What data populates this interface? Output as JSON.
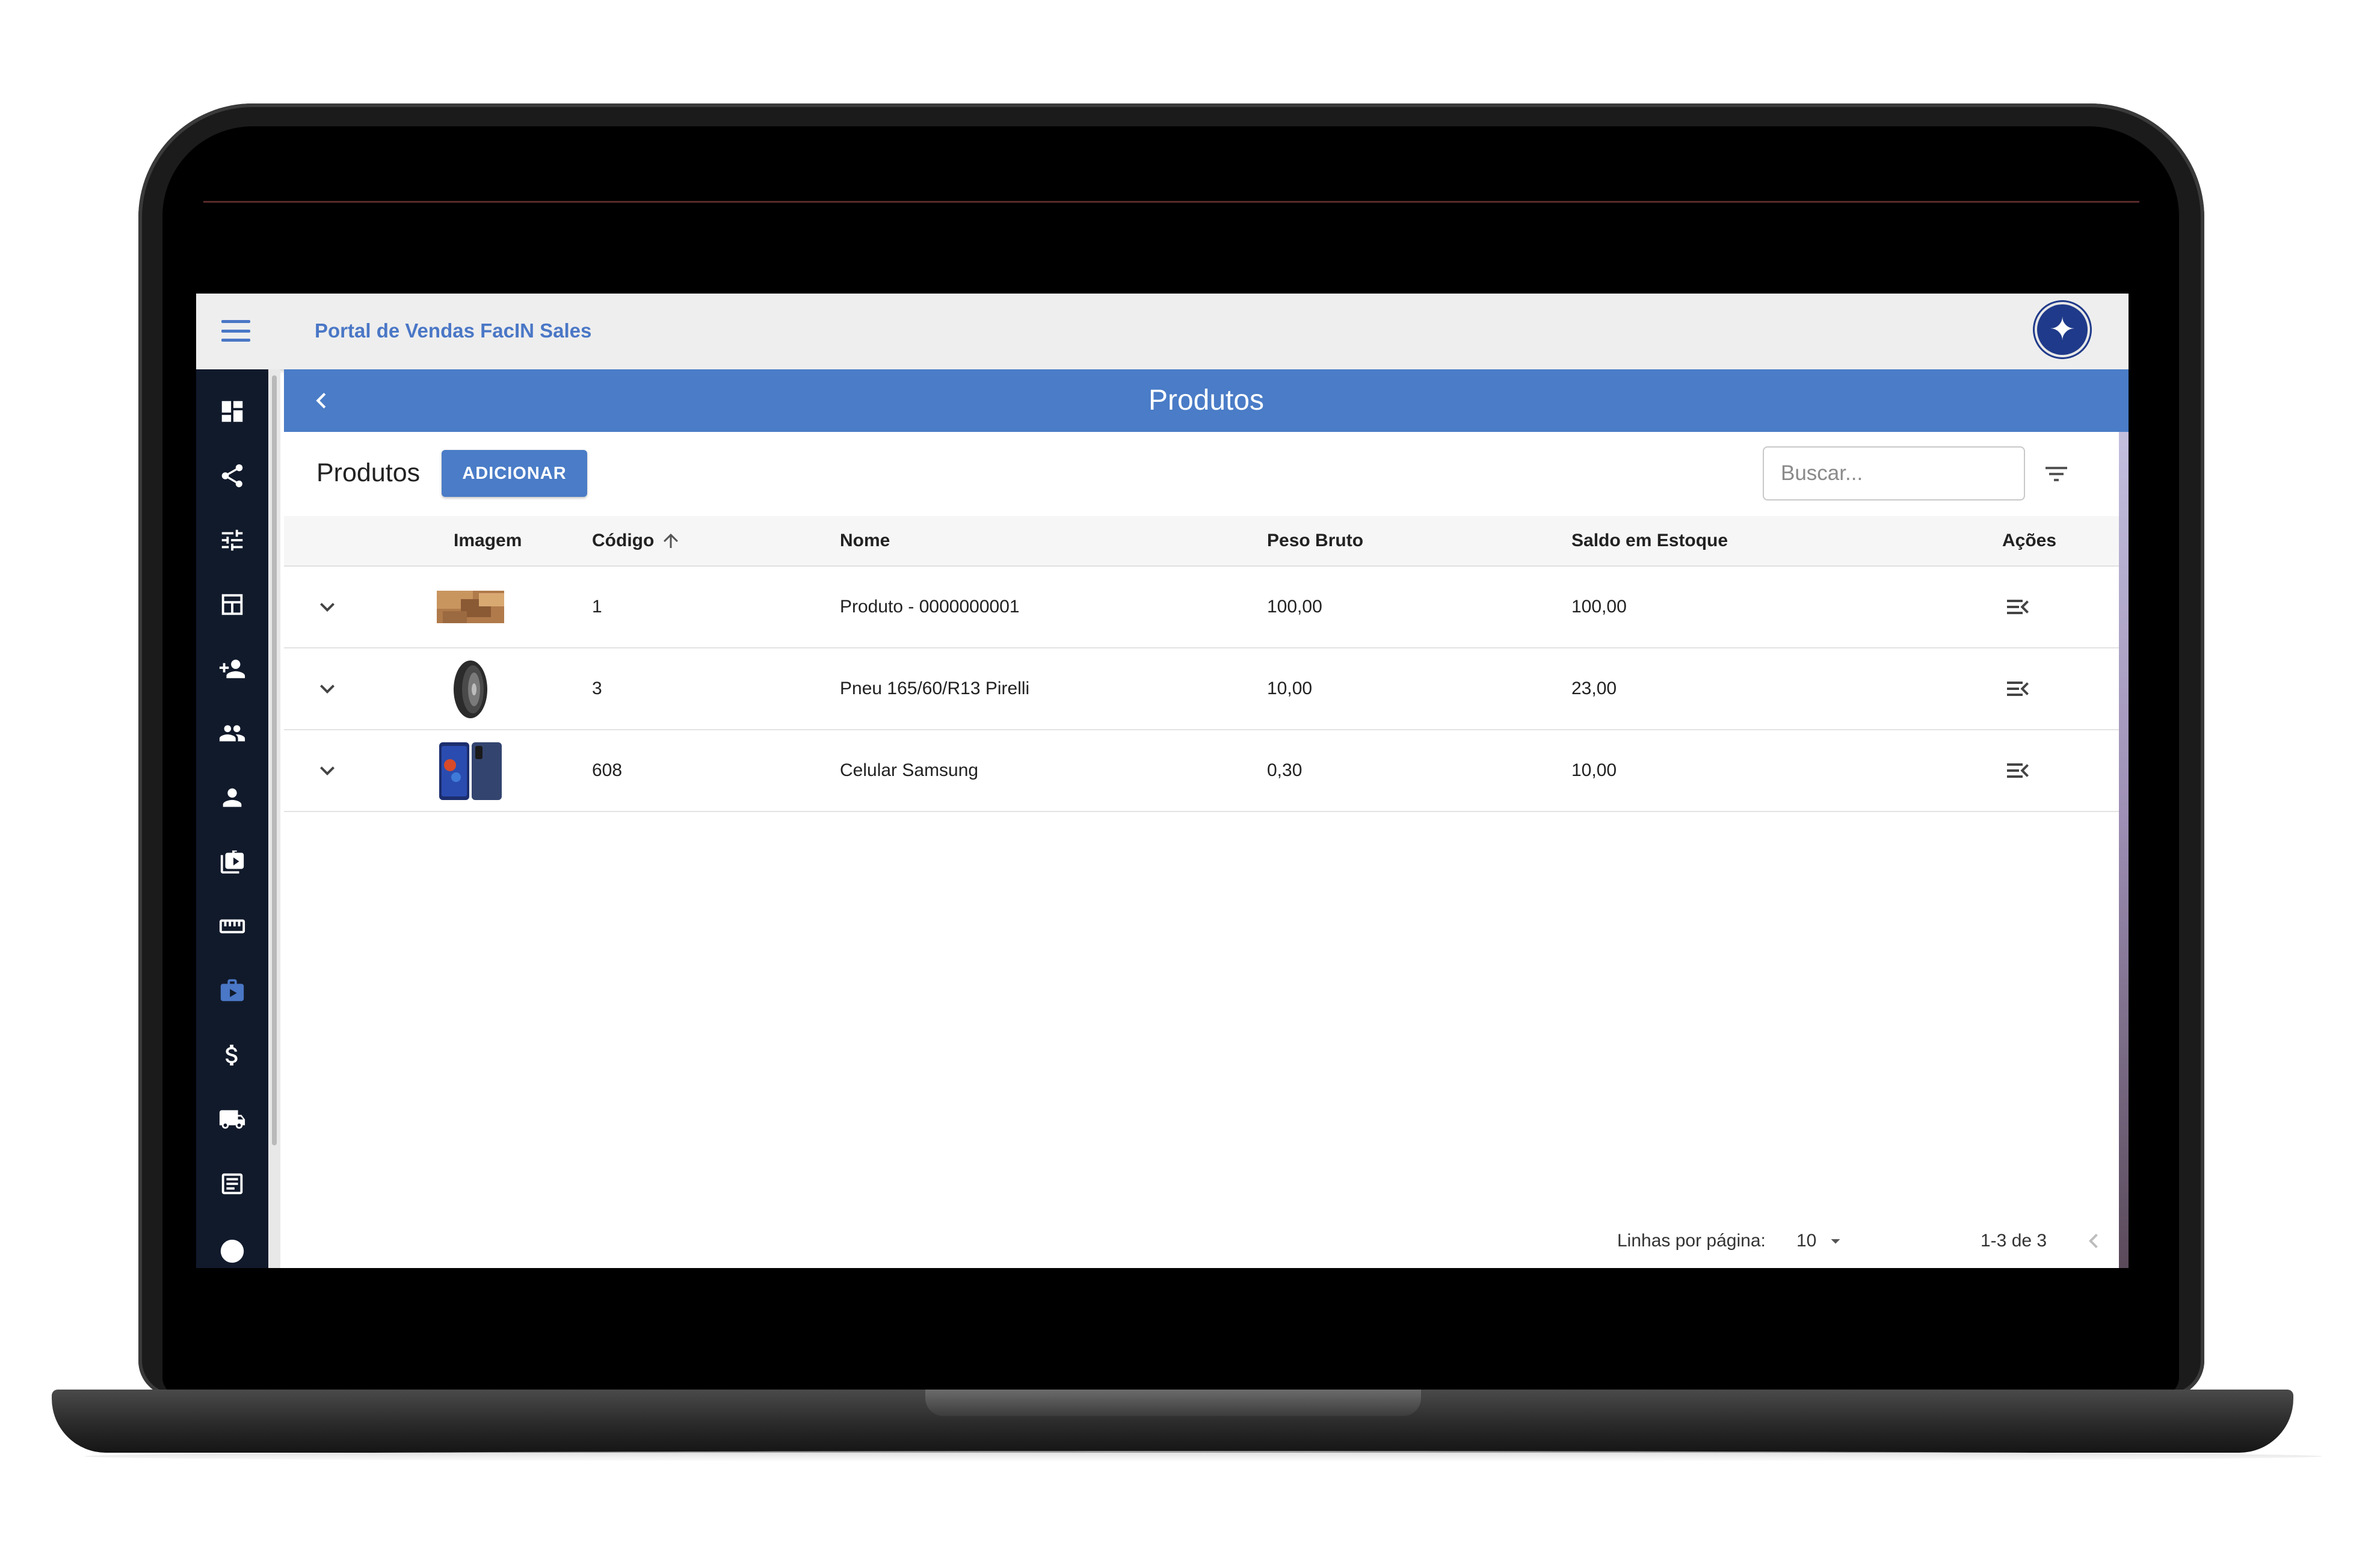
{
  "app": {
    "title": "Portal de Vendas FacIN Sales"
  },
  "page": {
    "title": "Produtos"
  },
  "toolbar": {
    "section_title": "Produtos",
    "add_label": "ADICIONAR",
    "search_placeholder": "Buscar..."
  },
  "table": {
    "headers": {
      "imagem": "Imagem",
      "codigo": "Código",
      "nome": "Nome",
      "peso": "Peso Bruto",
      "saldo": "Saldo em Estoque",
      "acoes": "Ações"
    },
    "sort": {
      "column": "codigo",
      "direction": "ascending"
    },
    "rows": [
      {
        "codigo": "1",
        "nome": "Produto - 0000000001",
        "peso": "100,00",
        "saldo": "100,00",
        "image": "wood-box-thumbnail"
      },
      {
        "codigo": "3",
        "nome": "Pneu 165/60/R13 Pirelli",
        "peso": "10,00",
        "saldo": "23,00",
        "image": "tire-thumbnail"
      },
      {
        "codigo": "608",
        "nome": "Celular Samsung",
        "peso": "0,30",
        "saldo": "10,00",
        "image": "phone-thumbnail"
      }
    ]
  },
  "pagination": {
    "rows_label": "Linhas por página:",
    "rows_value": "10",
    "range": "1-3 de 3"
  },
  "sidebar": {
    "active_index": 9,
    "icons": [
      "dashboard-icon",
      "share-icon",
      "tune-icon",
      "table-icon",
      "person-add-icon",
      "people-icon",
      "person-icon",
      "briefcase-icon",
      "ruler-icon",
      "briefcase-play-icon",
      "dollar-icon",
      "truck-icon",
      "list-icon",
      "help-icon"
    ]
  },
  "colors": {
    "primary": "#4a7cc7",
    "sidebar": "#111a2b",
    "topbar": "#eeeeee",
    "logo": "#1f3a8a"
  }
}
